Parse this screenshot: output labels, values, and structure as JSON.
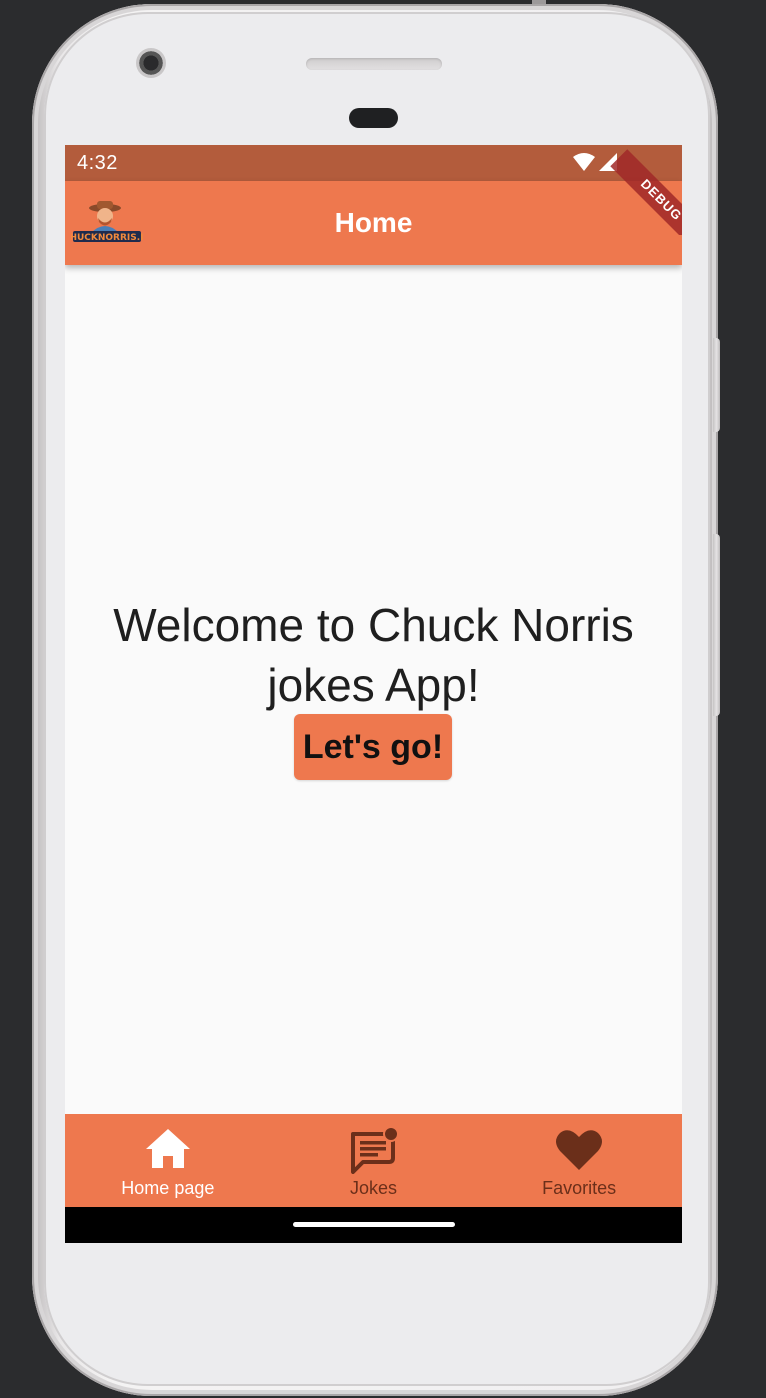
{
  "status_bar": {
    "time": "4:32",
    "icons": [
      "wifi-icon",
      "signal-icon"
    ],
    "color": "#b35c3c"
  },
  "debug_banner": {
    "label": "DEBUG"
  },
  "app_bar": {
    "title": "Home",
    "logo_icon": "chucknorris-logo-icon",
    "color": "#ee784e"
  },
  "main": {
    "welcome_text": "Welcome to Chuck Norris jokes App!",
    "go_button_label": "Let's go!"
  },
  "bottom_nav": {
    "active_color": "#ffffff",
    "inactive_color": "#6b2f1a",
    "items": [
      {
        "label": "Home page",
        "icon": "home-icon",
        "active": true
      },
      {
        "label": "Jokes",
        "icon": "chat-bubble-icon",
        "active": false
      },
      {
        "label": "Favorites",
        "icon": "heart-icon",
        "active": false
      }
    ]
  }
}
